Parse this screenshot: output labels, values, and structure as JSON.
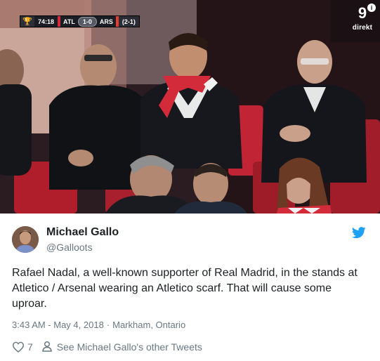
{
  "broadcast": {
    "competition_icon": "trophy-icon",
    "clock": "74:18",
    "home_team": "ATL",
    "score": "1-0",
    "away_team": "ARS",
    "aggregate": "(2-1)",
    "channel_number": "9",
    "channel_label": "direkt",
    "info_icon": "i"
  },
  "tweet": {
    "author_name": "Michael Gallo",
    "author_handle": "@Galloots",
    "text": "Rafael Nadal, a well-known supporter of Real Madrid, in the stands at Atletico / Arsenal wearing an Atletico scarf. That will cause some uproar.",
    "time": "3:43 AM - May 4, 2018",
    "separator": "·",
    "location": "Markham, Ontario",
    "like_count": "7",
    "other_tweets_label": "See Michael Gallo's other Tweets"
  },
  "colors": {
    "twitter_blue": "#1da1f2",
    "meta_gray": "#697882",
    "text": "#1c2022",
    "scarf_red": "#d42b3a"
  }
}
